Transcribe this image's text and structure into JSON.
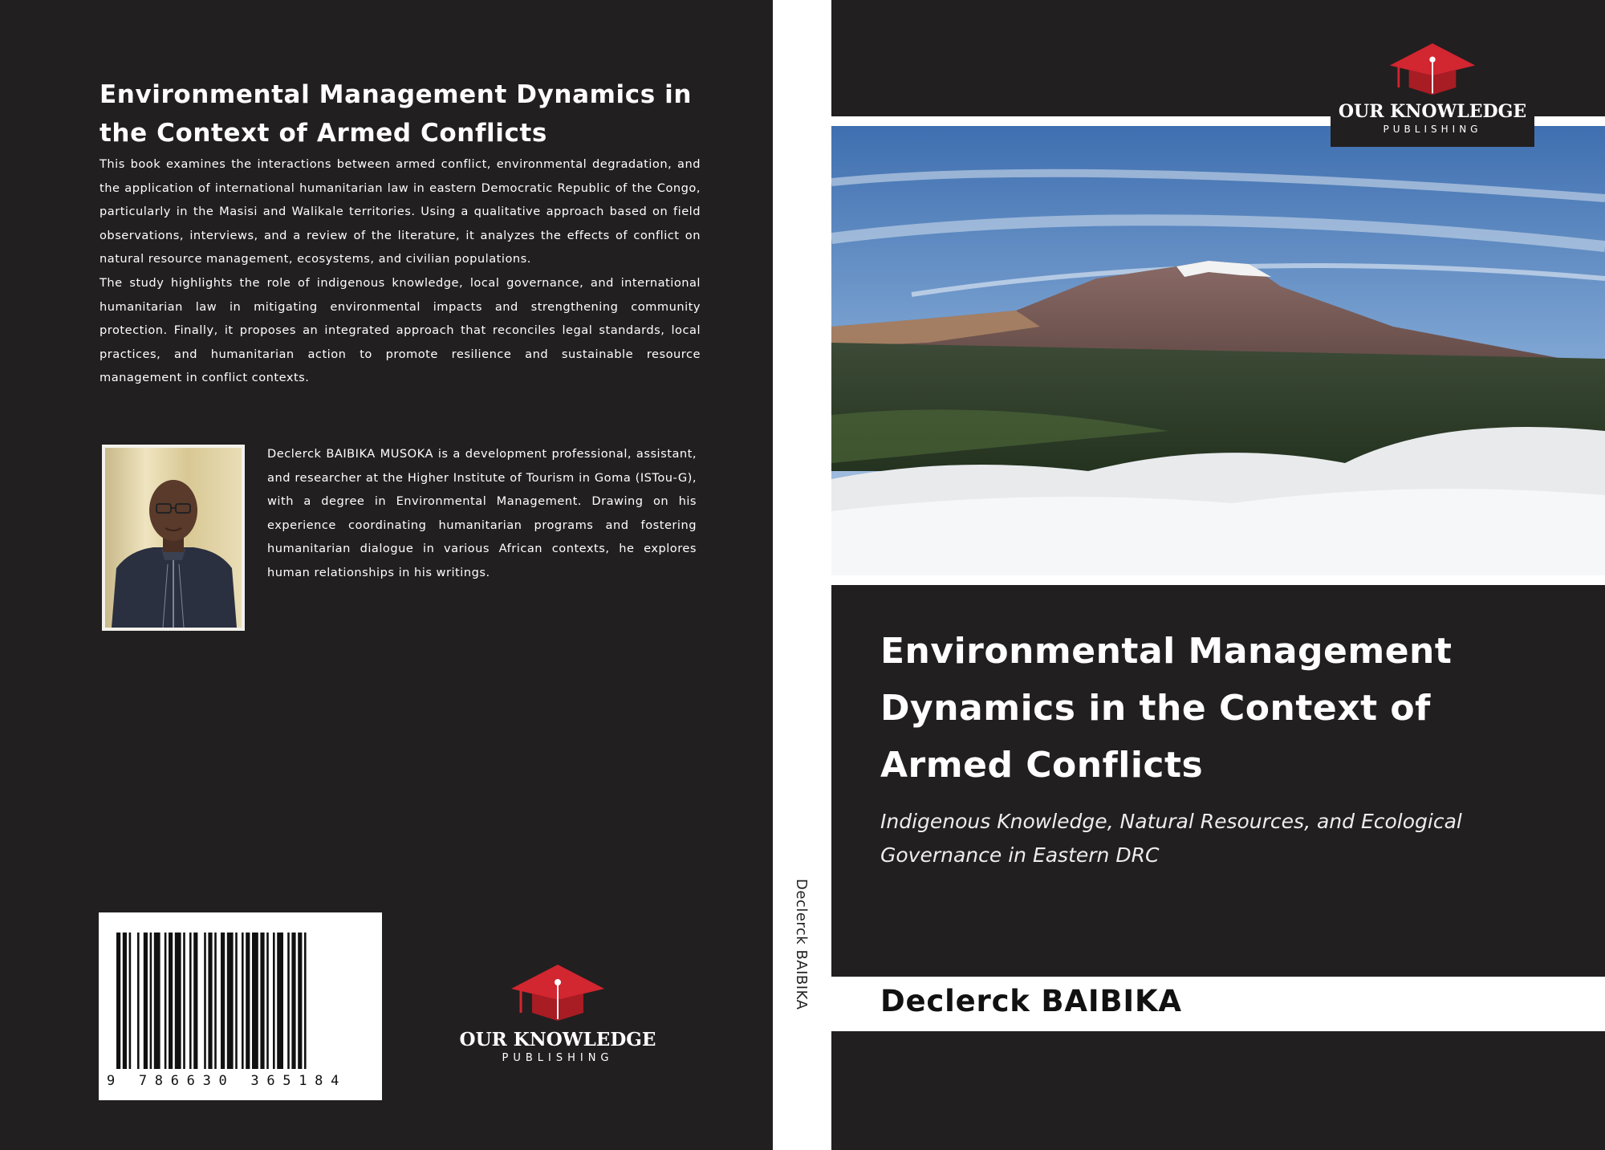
{
  "back_cover": {
    "title": "Environmental Management Dynamics in the Context of Armed Conflicts",
    "blurb_paragraphs": [
      "This book examines the interactions between armed conflict, environmental degradation, and the application of international humanitarian law in eastern Democratic Republic of the Congo, particularly in the Masisi and Walikale territories. Using a qualitative approach based on field observations, interviews, and a review of the literature, it analyzes the effects of conflict on natural resource management, ecosystems, and civilian populations.",
      "The study highlights the role of indigenous knowledge, local governance, and international humanitarian law in mitigating environmental impacts and strengthening community protection. Finally, it proposes an integrated approach that reconciles legal standards, local practices, and humanitarian action to promote resilience and sustainable resource management in conflict contexts."
    ],
    "author_bio": "Declerck BAIBIKA MUSOKA is a development professional, assistant, and researcher at the Higher Institute of Tourism in Goma (ISTou-G), with a degree in Environmental Management. Drawing on his experience coordinating humanitarian programs and fostering humanitarian dialogue in various African contexts, he explores human relationships in his writings.",
    "isbn_digits": "9 786630 365184",
    "publisher": {
      "name": "OUR KNOWLEDGE",
      "sub": "PUBLISHING"
    }
  },
  "spine": {
    "author": "Declerck BAIBIKA"
  },
  "front_cover": {
    "publisher": {
      "name": "OUR KNOWLEDGE",
      "sub": "PUBLISHING"
    },
    "title": "Environmental Management Dynamics in the Context of Armed Conflicts",
    "subtitle": "Indigenous Knowledge, Natural Resources, and Ecological Governance in Eastern DRC",
    "author": "Declerck BAIBIKA"
  },
  "colors": {
    "cover_dark": "#221f20",
    "logo_red": "#d22630",
    "paper_white": "#ffffff"
  }
}
